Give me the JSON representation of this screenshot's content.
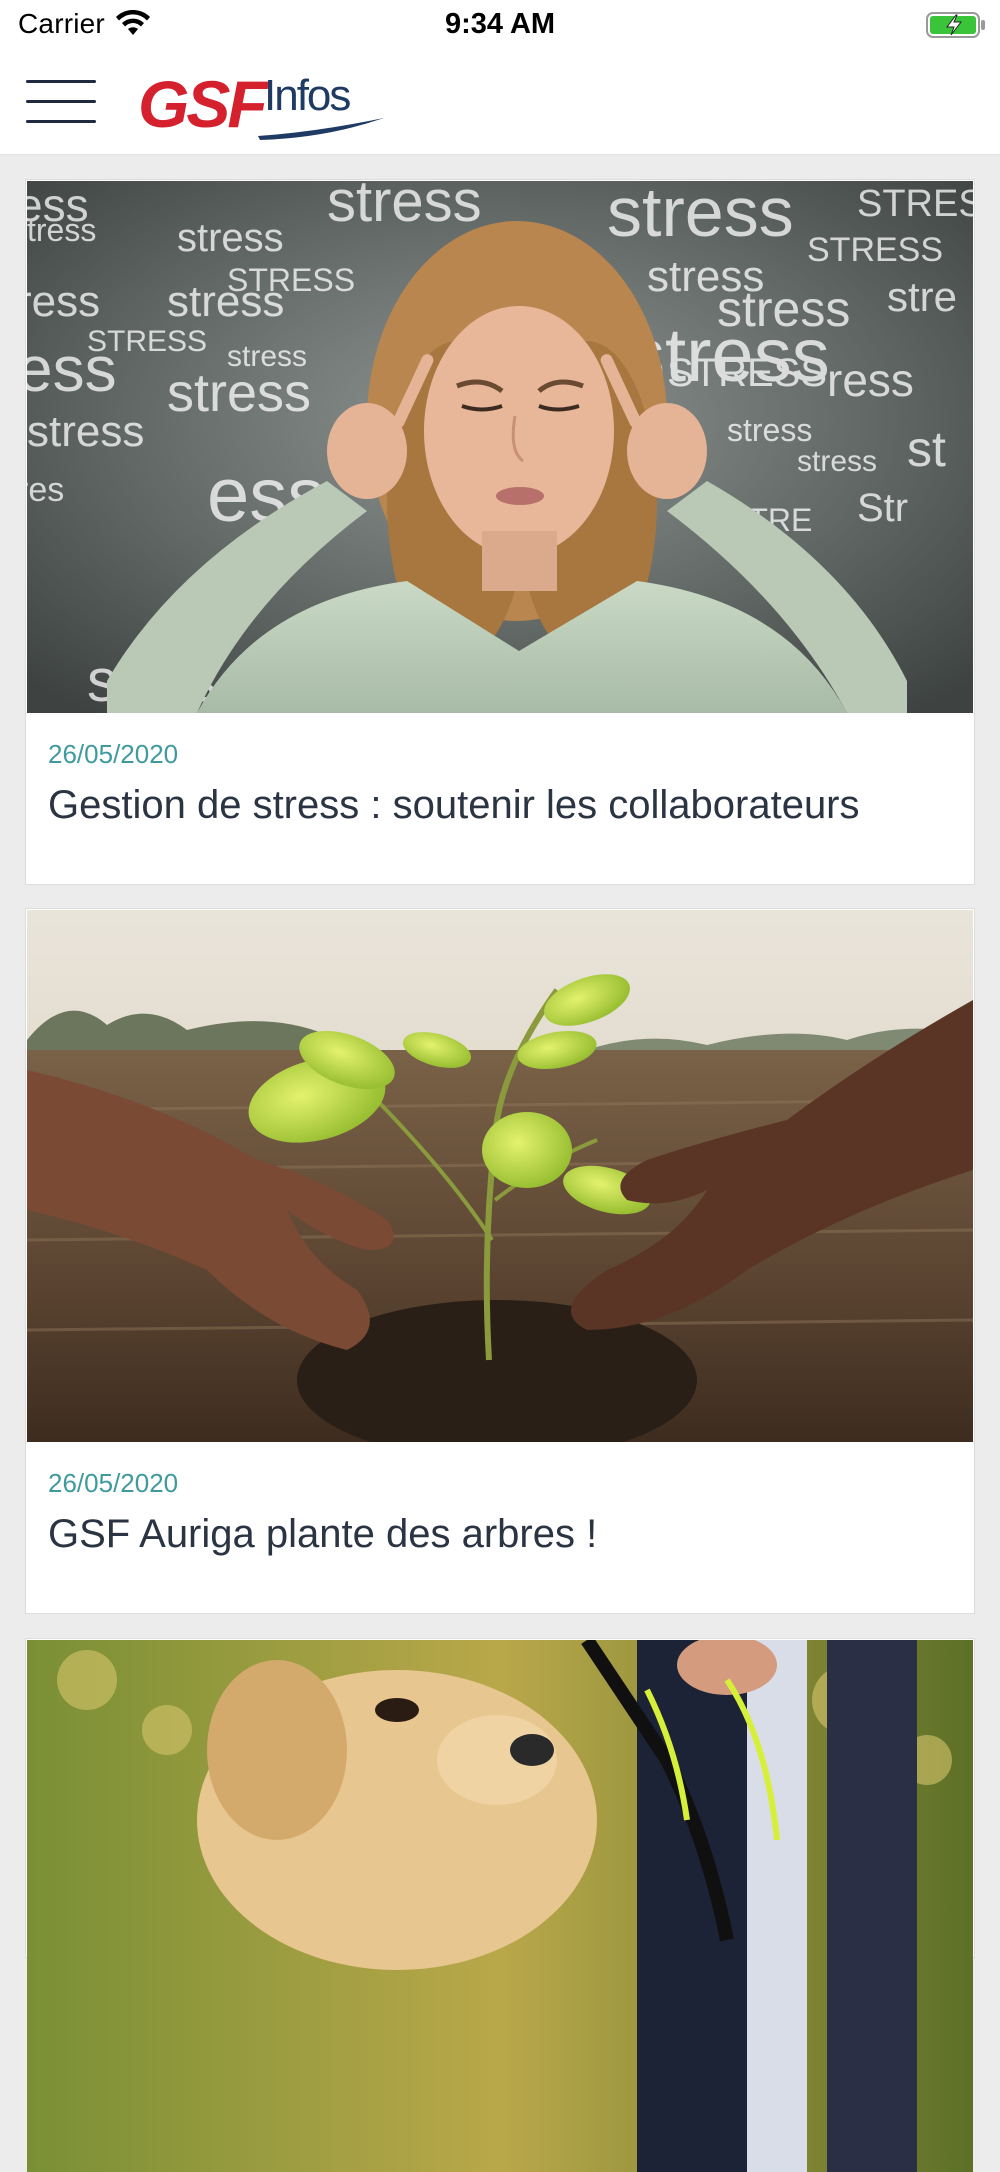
{
  "status_bar": {
    "carrier": "Carrier",
    "time": "9:34 AM",
    "wifi_icon": "wifi-icon",
    "battery_icon": "battery-charging-icon"
  },
  "header": {
    "menu_icon": "hamburger-menu-icon",
    "logo": {
      "brand": "GSF",
      "product": "Infos",
      "brand_color": "#d5202e",
      "product_color": "#1f3a63"
    }
  },
  "articles": [
    {
      "date": "26/05/2020",
      "title": "Gestion de stress : soutenir les collaborateurs",
      "image": "woman-stressed-photo"
    },
    {
      "date": "26/05/2020",
      "title": "GSF Auriga plante des arbres !",
      "image": "hands-planting-seedling-photo"
    },
    {
      "date": "",
      "title": "",
      "image": "dog-on-leash-photo"
    }
  ],
  "colors": {
    "date_accent": "#3f9aa0",
    "title_text": "#2b3442",
    "background": "#ececec"
  }
}
